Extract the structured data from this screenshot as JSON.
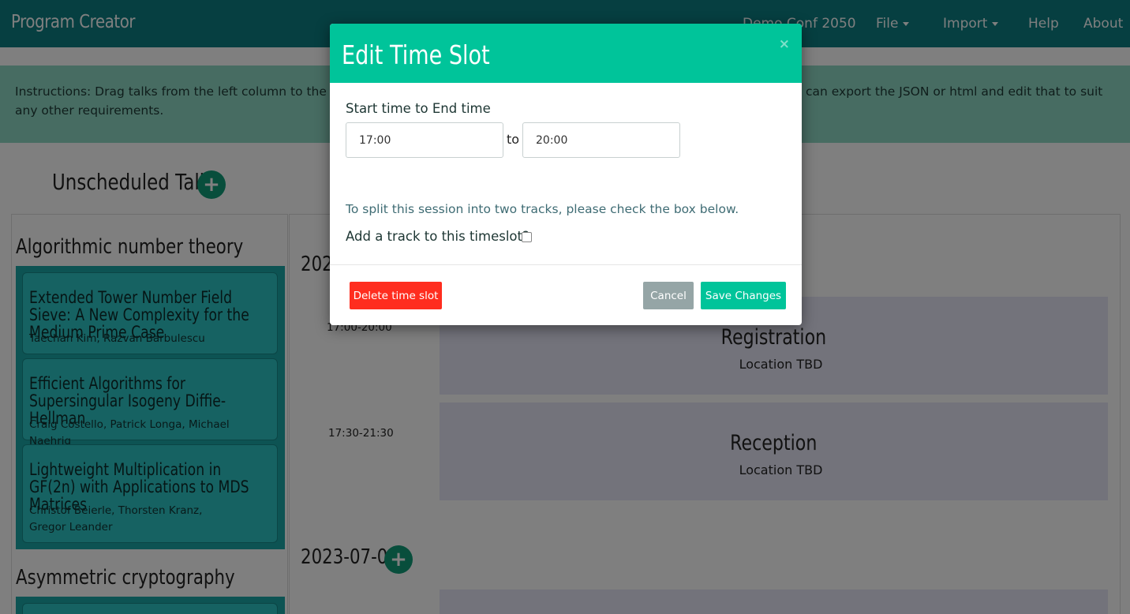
{
  "navbar": {
    "brand": "Program Creator",
    "conference": "Demo Conf 2050",
    "file": "File",
    "import": "Import",
    "help": "Help",
    "about": "About"
  },
  "instructions": {
    "text_left": "Instructions: Drag talks from the left column to the",
    "text_right": "can export the JSON or html and edit that to suit",
    "text_line2": "any other requirements."
  },
  "unscheduled": {
    "title": "Unscheduled Talks",
    "categories": [
      {
        "name": "Algorithmic number theory",
        "talks": [
          {
            "title": "Extended Tower Number Field Sieve: A New Complexity for the Medium Prime Case",
            "authors": "Taechan Kim, Razvan Barbulescu"
          },
          {
            "title": "Efficient Algorithms for Supersingular Isogeny Diffie-Hellman",
            "authors": "Craig Costello, Patrick Longa, Michael Naehrig"
          },
          {
            "title": "Lightweight Multiplication in GF(2n) with Applications to MDS Matrices",
            "authors": "Christof Beierle, Thorsten Kranz, Gregor Leander"
          }
        ]
      },
      {
        "name": "Asymmetric cryptography"
      }
    ]
  },
  "schedule": {
    "date1": "2023",
    "date2": "2023-07-06",
    "slots": [
      {
        "time": "17:00-20:00",
        "title": "Registration",
        "location": "Location TBD"
      },
      {
        "time": "17:30-21:30",
        "title": "Reception",
        "location": "Location TBD"
      }
    ]
  },
  "modal": {
    "title": "Edit Time Slot",
    "close": "×",
    "label": "Start time to End time",
    "start_time": "17:00",
    "end_time": "20:00",
    "to": "to",
    "split_text": "To split this session into two tracks, please check the box below.",
    "track_label": "Add a track to this timeslot?",
    "delete_label": "Delete time slot",
    "cancel_label": "Cancel",
    "save_label": "Save Changes"
  },
  "colors": {
    "navbar": "#0d7e83",
    "accent": "#00c49a",
    "danger": "#ff2d1f",
    "plus": "#109c78"
  }
}
